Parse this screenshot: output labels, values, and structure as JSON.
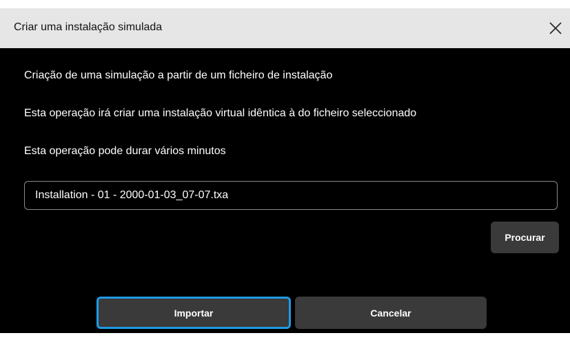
{
  "dialog": {
    "title": "Criar uma instalação simulada",
    "close_icon": "close-icon",
    "lines": [
      "Criação de uma simulação a partir de um ficheiro de instalação",
      "Esta operação irá criar uma instalação virtual idêntica à do ficheiro seleccionado",
      "Esta operação pode durar vários minutos"
    ],
    "file_input_value": "Installation - 01 - 2000-01-03_07-07.txa",
    "browse_label": "Procurar",
    "import_label": "Importar",
    "cancel_label": "Cancelar"
  },
  "colors": {
    "dialog_background": "#000000",
    "titlebar_background": "#e6e6e6",
    "button_background": "#3a3a3a",
    "focus_ring": "#1e9be6"
  }
}
